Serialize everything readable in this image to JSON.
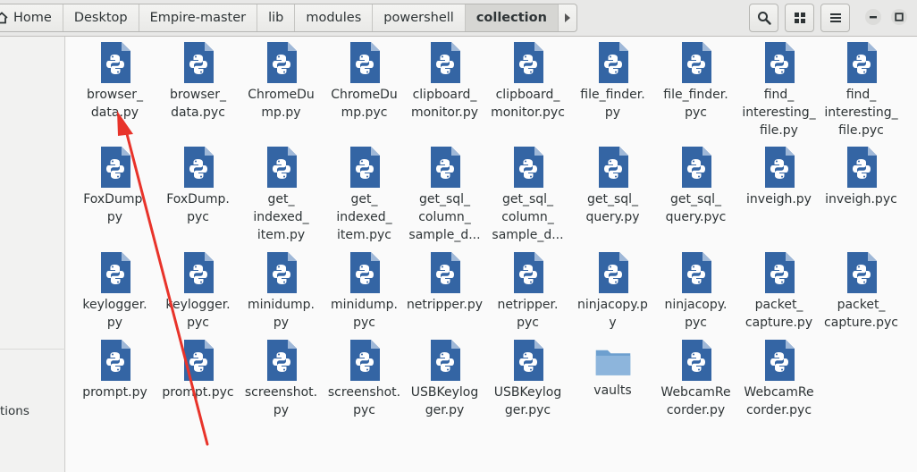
{
  "breadcrumb": {
    "items": [
      {
        "label": "Home",
        "icon": "home-icon"
      },
      {
        "label": "Desktop"
      },
      {
        "label": "Empire-master"
      },
      {
        "label": "lib"
      },
      {
        "label": "modules"
      },
      {
        "label": "powershell"
      },
      {
        "label": "collection",
        "active": true
      }
    ],
    "next_icon": "chevron-right-icon"
  },
  "toolbar": {
    "search_icon": "search-icon",
    "view_icon": "grid-view-icon",
    "menu_icon": "hamburger-menu-icon",
    "minimize_icon": "minimize-icon",
    "maximize_icon": "maximize-icon"
  },
  "sidebar": {
    "partial_label": "tions"
  },
  "files": [
    {
      "name": "browser_\ndata.py",
      "type": "python"
    },
    {
      "name": "browser_\ndata.pyc",
      "type": "python"
    },
    {
      "name": "ChromeDu\nmp.py",
      "type": "python"
    },
    {
      "name": "ChromeDu\nmp.pyc",
      "type": "python"
    },
    {
      "name": "clipboard_\nmonitor.py",
      "type": "python"
    },
    {
      "name": "clipboard_\nmonitor.pyc",
      "type": "python"
    },
    {
      "name": "file_finder.\npy",
      "type": "python"
    },
    {
      "name": "file_finder.\npyc",
      "type": "python"
    },
    {
      "name": "find_\ninteresting_\nfile.py",
      "type": "python"
    },
    {
      "name": "find_\ninteresting_\nfile.pyc",
      "type": "python"
    },
    {
      "name": "FoxDump.\npy",
      "type": "python"
    },
    {
      "name": "FoxDump.\npyc",
      "type": "python"
    },
    {
      "name": "get_\nindexed_\nitem.py",
      "type": "python"
    },
    {
      "name": "get_\nindexed_\nitem.pyc",
      "type": "python"
    },
    {
      "name": "get_sql_\ncolumn_\nsample_d...",
      "type": "python"
    },
    {
      "name": "get_sql_\ncolumn_\nsample_d...",
      "type": "python"
    },
    {
      "name": "get_sql_\nquery.py",
      "type": "python"
    },
    {
      "name": "get_sql_\nquery.pyc",
      "type": "python"
    },
    {
      "name": "inveigh.py",
      "type": "python"
    },
    {
      "name": "inveigh.pyc",
      "type": "python"
    },
    {
      "name": "keylogger.\npy",
      "type": "python"
    },
    {
      "name": "keylogger.\npyc",
      "type": "python"
    },
    {
      "name": "minidump.\npy",
      "type": "python"
    },
    {
      "name": "minidump.\npyc",
      "type": "python"
    },
    {
      "name": "netripper.py",
      "type": "python"
    },
    {
      "name": "netripper.\npyc",
      "type": "python"
    },
    {
      "name": "ninjacopy.py",
      "type": "python"
    },
    {
      "name": "ninjacopy.\npyc",
      "type": "python"
    },
    {
      "name": "packet_\ncapture.py",
      "type": "python"
    },
    {
      "name": "packet_\ncapture.pyc",
      "type": "python"
    },
    {
      "name": "prompt.py",
      "type": "python"
    },
    {
      "name": "prompt.pyc",
      "type": "python"
    },
    {
      "name": "screenshot.\npy",
      "type": "python"
    },
    {
      "name": "screenshot.\npyc",
      "type": "python"
    },
    {
      "name": "USBKeylog\nger.py",
      "type": "python"
    },
    {
      "name": "USBKeylog\nger.pyc",
      "type": "python"
    },
    {
      "name": "vaults",
      "type": "folder"
    },
    {
      "name": "WebcamRe\ncorder.py",
      "type": "python"
    },
    {
      "name": "WebcamRe\ncorder.pyc",
      "type": "python"
    }
  ],
  "colors": {
    "python_icon": "#3465a4",
    "python_fold": "#9fb8d8",
    "folder": "#6d9fcf",
    "annotation_arrow": "#e8332a"
  }
}
